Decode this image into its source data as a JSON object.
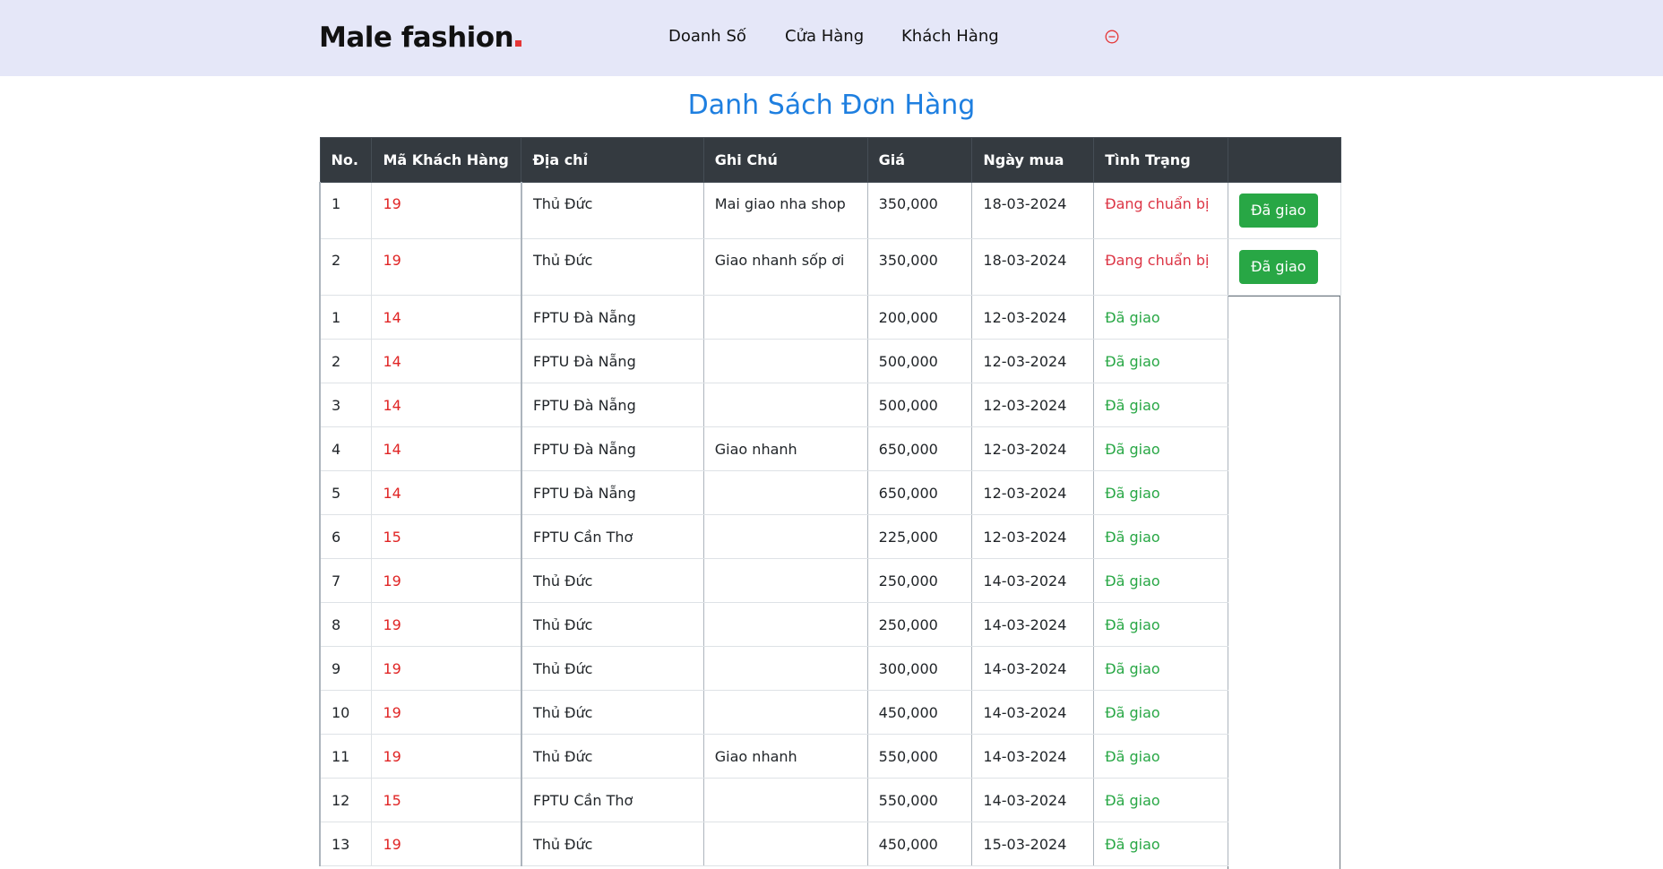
{
  "brand": {
    "name": "Male fashion"
  },
  "nav": {
    "items": [
      "Doanh Số",
      "Cửa Hàng",
      "Khách Hàng"
    ],
    "logout_icon": "circle-minus-icon",
    "logout_color": "#e53637"
  },
  "page": {
    "title": "Danh Sách Đơn Hàng"
  },
  "table": {
    "headers": [
      "No.",
      "Mã Khách Hàng",
      "Địa chỉ",
      "Ghi Chú",
      "Giá",
      "Ngày mua",
      "Tình Trạng",
      ""
    ],
    "action_label": "Đã giao",
    "rows": [
      {
        "no": "1",
        "customer": "19",
        "address": "Thủ Đức",
        "note": "Mai giao nha shop",
        "price": "350,000",
        "date": "18-03-2024",
        "status": "Đang chuẩn bị"
      },
      {
        "no": "2",
        "customer": "19",
        "address": "Thủ Đức",
        "note": "Giao nhanh sốp ơi",
        "price": "350,000",
        "date": "18-03-2024",
        "status": "Đang chuẩn bị"
      },
      {
        "no": "1",
        "customer": "14",
        "address": "FPTU Đà Nẵng",
        "note": "",
        "price": "200,000",
        "date": "12-03-2024",
        "status": "Đã giao"
      },
      {
        "no": "2",
        "customer": "14",
        "address": "FPTU Đà Nẵng",
        "note": "",
        "price": "500,000",
        "date": "12-03-2024",
        "status": "Đã giao"
      },
      {
        "no": "3",
        "customer": "14",
        "address": "FPTU Đà Nẵng",
        "note": "",
        "price": "500,000",
        "date": "12-03-2024",
        "status": "Đã giao"
      },
      {
        "no": "4",
        "customer": "14",
        "address": "FPTU Đà Nẵng",
        "note": "Giao nhanh",
        "price": "650,000",
        "date": "12-03-2024",
        "status": "Đã giao"
      },
      {
        "no": "5",
        "customer": "14",
        "address": "FPTU Đà Nẵng",
        "note": "",
        "price": "650,000",
        "date": "12-03-2024",
        "status": "Đã giao"
      },
      {
        "no": "6",
        "customer": "15",
        "address": "FPTU Cần Thơ",
        "note": "",
        "price": "225,000",
        "date": "12-03-2024",
        "status": "Đã giao"
      },
      {
        "no": "7",
        "customer": "19",
        "address": "Thủ Đức",
        "note": "",
        "price": "250,000",
        "date": "14-03-2024",
        "status": "Đã giao"
      },
      {
        "no": "8",
        "customer": "19",
        "address": "Thủ Đức",
        "note": "",
        "price": "250,000",
        "date": "14-03-2024",
        "status": "Đã giao"
      },
      {
        "no": "9",
        "customer": "19",
        "address": "Thủ Đức",
        "note": "",
        "price": "300,000",
        "date": "14-03-2024",
        "status": "Đã giao"
      },
      {
        "no": "10",
        "customer": "19",
        "address": "Thủ Đức",
        "note": "",
        "price": "450,000",
        "date": "14-03-2024",
        "status": "Đã giao"
      },
      {
        "no": "11",
        "customer": "19",
        "address": "Thủ Đức",
        "note": "Giao nhanh",
        "price": "550,000",
        "date": "14-03-2024",
        "status": "Đã giao"
      },
      {
        "no": "12",
        "customer": "15",
        "address": "FPTU Cần Thơ",
        "note": "",
        "price": "550,000",
        "date": "14-03-2024",
        "status": "Đã giao"
      },
      {
        "no": "13",
        "customer": "19",
        "address": "Thủ Đức",
        "note": "",
        "price": "450,000",
        "date": "15-03-2024",
        "status": "Đã giao"
      }
    ]
  },
  "colors": {
    "header_bg": "#e5e7f8",
    "title": "#1e7fe0",
    "table_head": "#343a40",
    "customer_id": "#e02424",
    "status_pending": "#dc3545",
    "status_done": "#28a745",
    "button": "#28a745"
  }
}
